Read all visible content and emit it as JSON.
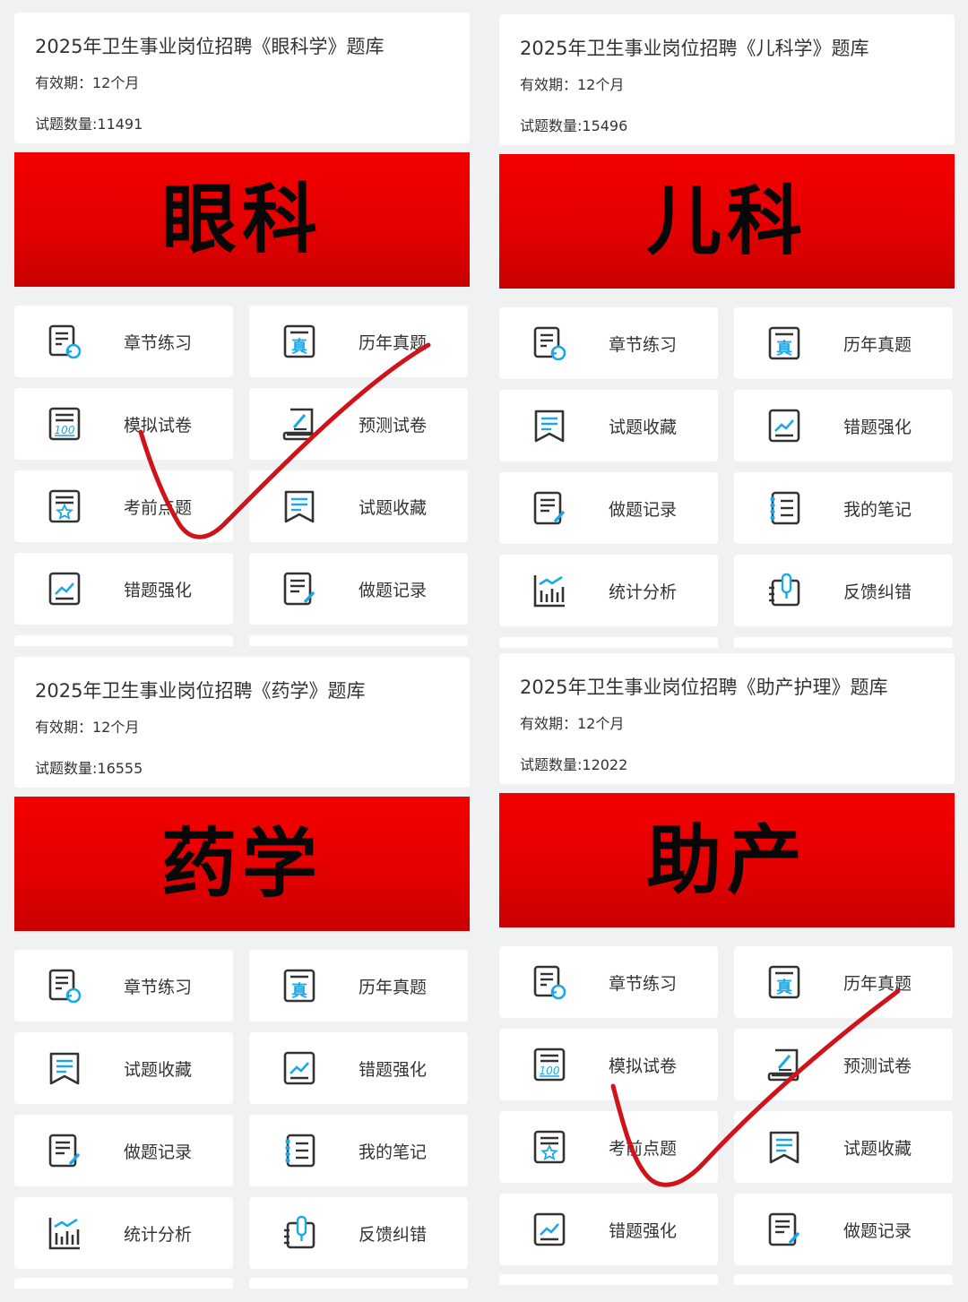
{
  "colors": {
    "banner_red": "#e40000",
    "icon_blue": "#1aa8e8",
    "check_red": "#d0131a"
  },
  "panels": [
    {
      "title": "2025年卫生事业岗位招聘《眼科学》题库",
      "validity": "有效期：12个月",
      "count": "试题数量:11491",
      "banner": "眼科",
      "tiles": [
        {
          "label": "章节练习",
          "icon": "chapter-practice-icon"
        },
        {
          "label": "历年真题",
          "icon": "past-exam-icon"
        },
        {
          "label": "模拟试卷",
          "icon": "mock-exam-icon"
        },
        {
          "label": "预测试卷",
          "icon": "forecast-exam-icon"
        },
        {
          "label": "考前点题",
          "icon": "key-points-icon"
        },
        {
          "label": "试题收藏",
          "icon": "bookmark-icon"
        },
        {
          "label": "错题强化",
          "icon": "wrong-answer-icon"
        },
        {
          "label": "做题记录",
          "icon": "record-icon"
        }
      ]
    },
    {
      "title": "2025年卫生事业岗位招聘《儿科学》题库",
      "validity": "有效期：12个月",
      "count": "试题数量:15496",
      "banner": "儿科",
      "tiles": [
        {
          "label": "章节练习",
          "icon": "chapter-practice-icon"
        },
        {
          "label": "历年真题",
          "icon": "past-exam-icon"
        },
        {
          "label": "试题收藏",
          "icon": "bookmark-icon"
        },
        {
          "label": "错题强化",
          "icon": "wrong-answer-icon"
        },
        {
          "label": "做题记录",
          "icon": "record-icon"
        },
        {
          "label": "我的笔记",
          "icon": "notes-icon"
        },
        {
          "label": "统计分析",
          "icon": "statistics-icon"
        },
        {
          "label": "反馈纠错",
          "icon": "feedback-icon"
        }
      ]
    },
    {
      "title": "2025年卫生事业岗位招聘《药学》题库",
      "validity": "有效期：12个月",
      "count": "试题数量:16555",
      "banner": "药学",
      "tiles": [
        {
          "label": "章节练习",
          "icon": "chapter-practice-icon"
        },
        {
          "label": "历年真题",
          "icon": "past-exam-icon"
        },
        {
          "label": "试题收藏",
          "icon": "bookmark-icon"
        },
        {
          "label": "错题强化",
          "icon": "wrong-answer-icon"
        },
        {
          "label": "做题记录",
          "icon": "record-icon"
        },
        {
          "label": "我的笔记",
          "icon": "notes-icon"
        },
        {
          "label": "统计分析",
          "icon": "statistics-icon"
        },
        {
          "label": "反馈纠错",
          "icon": "feedback-icon"
        }
      ]
    },
    {
      "title": "2025年卫生事业岗位招聘《助产护理》题库",
      "validity": "有效期：12个月",
      "count": "试题数量:12022",
      "banner": "助产",
      "tiles": [
        {
          "label": "章节练习",
          "icon": "chapter-practice-icon"
        },
        {
          "label": "历年真题",
          "icon": "past-exam-icon"
        },
        {
          "label": "模拟试卷",
          "icon": "mock-exam-icon"
        },
        {
          "label": "预测试卷",
          "icon": "forecast-exam-icon"
        },
        {
          "label": "考前点题",
          "icon": "key-points-icon"
        },
        {
          "label": "试题收藏",
          "icon": "bookmark-icon"
        },
        {
          "label": "错题强化",
          "icon": "wrong-answer-icon"
        },
        {
          "label": "做题记录",
          "icon": "record-icon"
        }
      ]
    }
  ]
}
